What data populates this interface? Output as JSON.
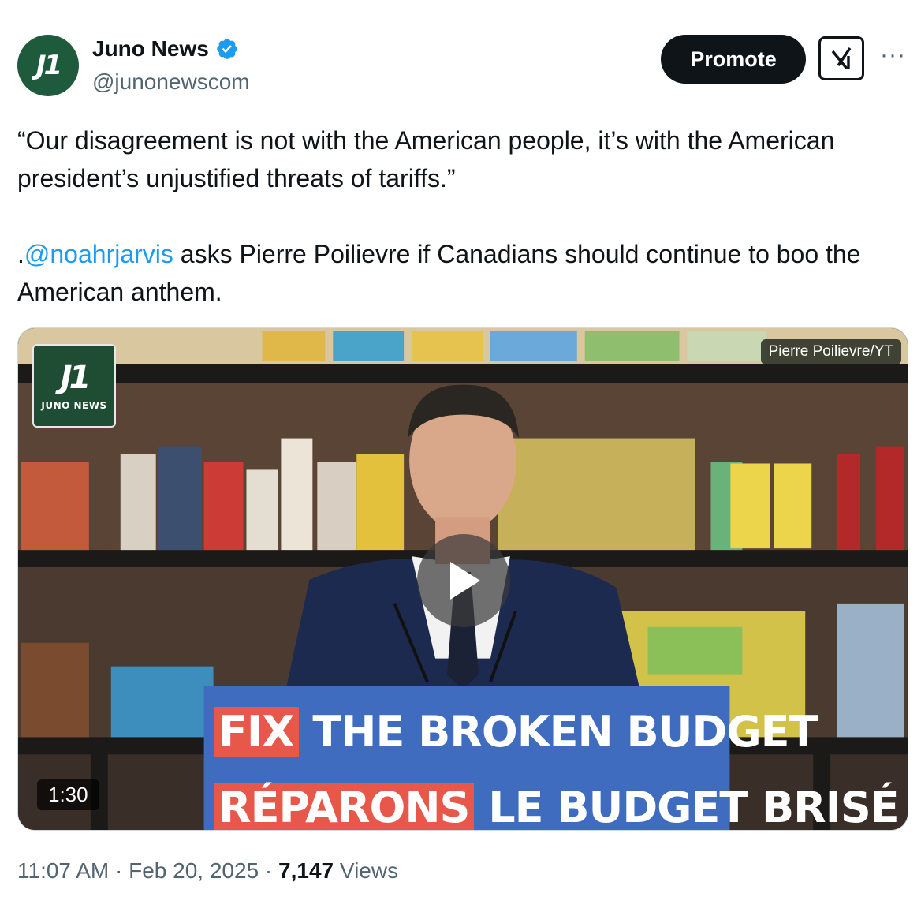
{
  "account": {
    "display_name": "Juno News",
    "handle": "@junonewscom",
    "avatar_text": "J1"
  },
  "actions": {
    "promote_label": "Promote",
    "grok_icon": "grok-icon",
    "more_icon": "more-icon"
  },
  "tweet": {
    "quote": "“Our disagreement is not with the American people, it’s with the American president’s unjustified threats of tariffs.”",
    "prefix": ".",
    "mention": "@noahrjarvis",
    "body": " asks Pierre Poilievre if Canadians should continue to boo the American anthem."
  },
  "video": {
    "logo_mark": "J1",
    "logo_word": "JUNO NEWS",
    "credit": "Pierre Poilievre/YT",
    "duration": "1:30",
    "podium_line1_highlight": "FIX",
    "podium_line1_rest": " THE BROKEN BUDGET",
    "podium_line2_highlight": "RÉPARONS",
    "podium_line2_rest": " LE BUDGET BRISÉ"
  },
  "meta": {
    "time": "11:07 AM",
    "separator": " · ",
    "date": "Feb 20, 2025",
    "views_count": "7,147",
    "views_label": " Views"
  },
  "colors": {
    "brand_green": "#1e5a3c",
    "link_blue": "#1d9bf0",
    "verified_blue": "#1d9bf0",
    "text_secondary": "#536471"
  }
}
